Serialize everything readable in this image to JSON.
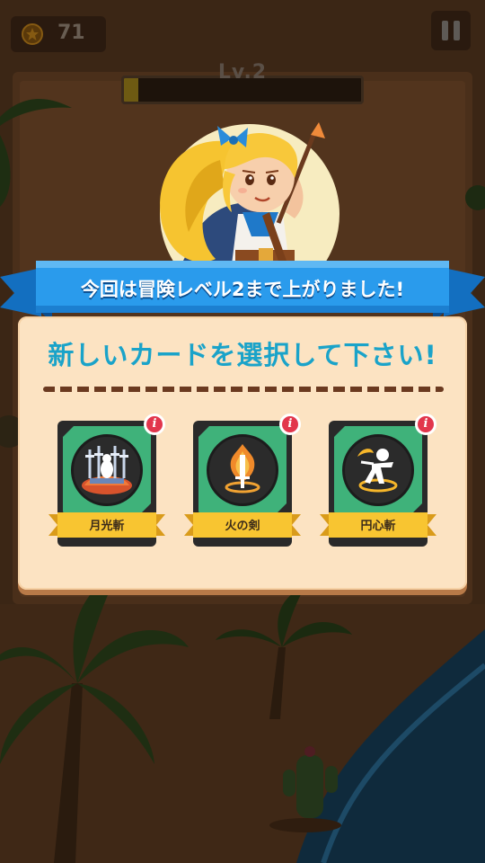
{
  "hud": {
    "coins": "71",
    "coin_icon": "coin-star-icon",
    "pause_icon": "pause-icon"
  },
  "level": {
    "label": "Lv.2",
    "progress": 0.06
  },
  "banner": {
    "message": "今回は冒険レベル2まで上がりました!"
  },
  "panel": {
    "title": "新しいカードを選択して下さい!"
  },
  "cards": [
    {
      "name": "月光斬",
      "icon": "moonlight-slash-icon",
      "info_icon": "info-icon"
    },
    {
      "name": "火の剣",
      "icon": "fire-sword-icon",
      "info_icon": "info-icon"
    },
    {
      "name": "円心斬",
      "icon": "circle-slash-icon",
      "info_icon": "info-icon"
    }
  ],
  "colors": {
    "ribbon_blue": "#1f8ee4",
    "panel_bg": "#fce3c2",
    "title_cyan": "#1aa3c9",
    "card_green": "#3fb27a",
    "label_yellow": "#f8c531",
    "info_red": "#e2364c"
  }
}
